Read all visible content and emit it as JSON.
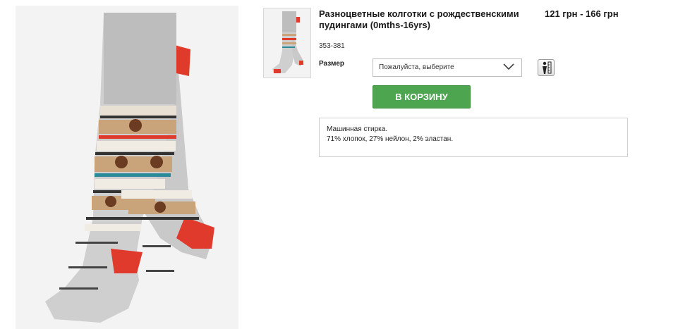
{
  "product": {
    "title": "Разноцветные колготки с рождественскими пудингами (0mths-16yrs)",
    "sku": "353-381",
    "price": "121 грн - 166 грн",
    "main_image_name": "product-main-image",
    "thumbnail_name": "product-thumbnail"
  },
  "size": {
    "label": "Размер",
    "selected": "Пожалуйста, выберите",
    "guide_icon": "size-guide-icon"
  },
  "actions": {
    "add_to_bag": "В КОРЗИНУ"
  },
  "description": {
    "care": "Машинная стирка.",
    "composition": "71% хлопок, 27% нейлон, 2% эластан."
  },
  "colors": {
    "button_green": "#4da54f",
    "sock_grey": "#bdbdbd",
    "sock_red": "#e03a2c"
  }
}
